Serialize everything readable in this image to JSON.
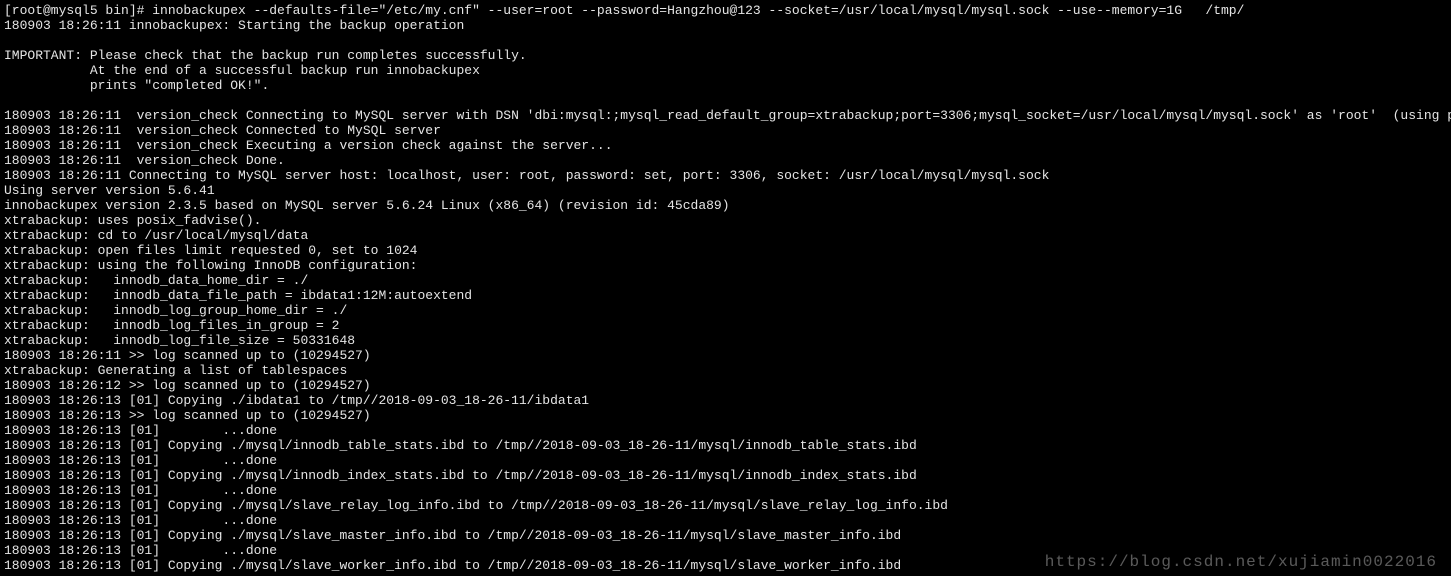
{
  "terminal": {
    "lines": [
      "[root@mysql5 bin]# innobackupex --defaults-file=\"/etc/my.cnf\" --user=root --password=Hangzhou@123 --socket=/usr/local/mysql/mysql.sock --use--memory=1G   /tmp/",
      "180903 18:26:11 innobackupex: Starting the backup operation",
      "",
      "IMPORTANT: Please check that the backup run completes successfully.",
      "           At the end of a successful backup run innobackupex",
      "           prints \"completed OK!\".",
      "",
      "180903 18:26:11  version_check Connecting to MySQL server with DSN 'dbi:mysql:;mysql_read_default_group=xtrabackup;port=3306;mysql_socket=/usr/local/mysql/mysql.sock' as 'root'  (using password: YES).",
      "180903 18:26:11  version_check Connected to MySQL server",
      "180903 18:26:11  version_check Executing a version check against the server...",
      "180903 18:26:11  version_check Done.",
      "180903 18:26:11 Connecting to MySQL server host: localhost, user: root, password: set, port: 3306, socket: /usr/local/mysql/mysql.sock",
      "Using server version 5.6.41",
      "innobackupex version 2.3.5 based on MySQL server 5.6.24 Linux (x86_64) (revision id: 45cda89)",
      "xtrabackup: uses posix_fadvise().",
      "xtrabackup: cd to /usr/local/mysql/data",
      "xtrabackup: open files limit requested 0, set to 1024",
      "xtrabackup: using the following InnoDB configuration:",
      "xtrabackup:   innodb_data_home_dir = ./",
      "xtrabackup:   innodb_data_file_path = ibdata1:12M:autoextend",
      "xtrabackup:   innodb_log_group_home_dir = ./",
      "xtrabackup:   innodb_log_files_in_group = 2",
      "xtrabackup:   innodb_log_file_size = 50331648",
      "180903 18:26:11 >> log scanned up to (10294527)",
      "xtrabackup: Generating a list of tablespaces",
      "180903 18:26:12 >> log scanned up to (10294527)",
      "180903 18:26:13 [01] Copying ./ibdata1 to /tmp//2018-09-03_18-26-11/ibdata1",
      "180903 18:26:13 >> log scanned up to (10294527)",
      "180903 18:26:13 [01]        ...done",
      "180903 18:26:13 [01] Copying ./mysql/innodb_table_stats.ibd to /tmp//2018-09-03_18-26-11/mysql/innodb_table_stats.ibd",
      "180903 18:26:13 [01]        ...done",
      "180903 18:26:13 [01] Copying ./mysql/innodb_index_stats.ibd to /tmp//2018-09-03_18-26-11/mysql/innodb_index_stats.ibd",
      "180903 18:26:13 [01]        ...done",
      "180903 18:26:13 [01] Copying ./mysql/slave_relay_log_info.ibd to /tmp//2018-09-03_18-26-11/mysql/slave_relay_log_info.ibd",
      "180903 18:26:13 [01]        ...done",
      "180903 18:26:13 [01] Copying ./mysql/slave_master_info.ibd to /tmp//2018-09-03_18-26-11/mysql/slave_master_info.ibd",
      "180903 18:26:13 [01]        ...done",
      "180903 18:26:13 [01] Copying ./mysql/slave_worker_info.ibd to /tmp//2018-09-03_18-26-11/mysql/slave_worker_info.ibd"
    ]
  },
  "watermark": "https://blog.csdn.net/xujiamin0022016"
}
